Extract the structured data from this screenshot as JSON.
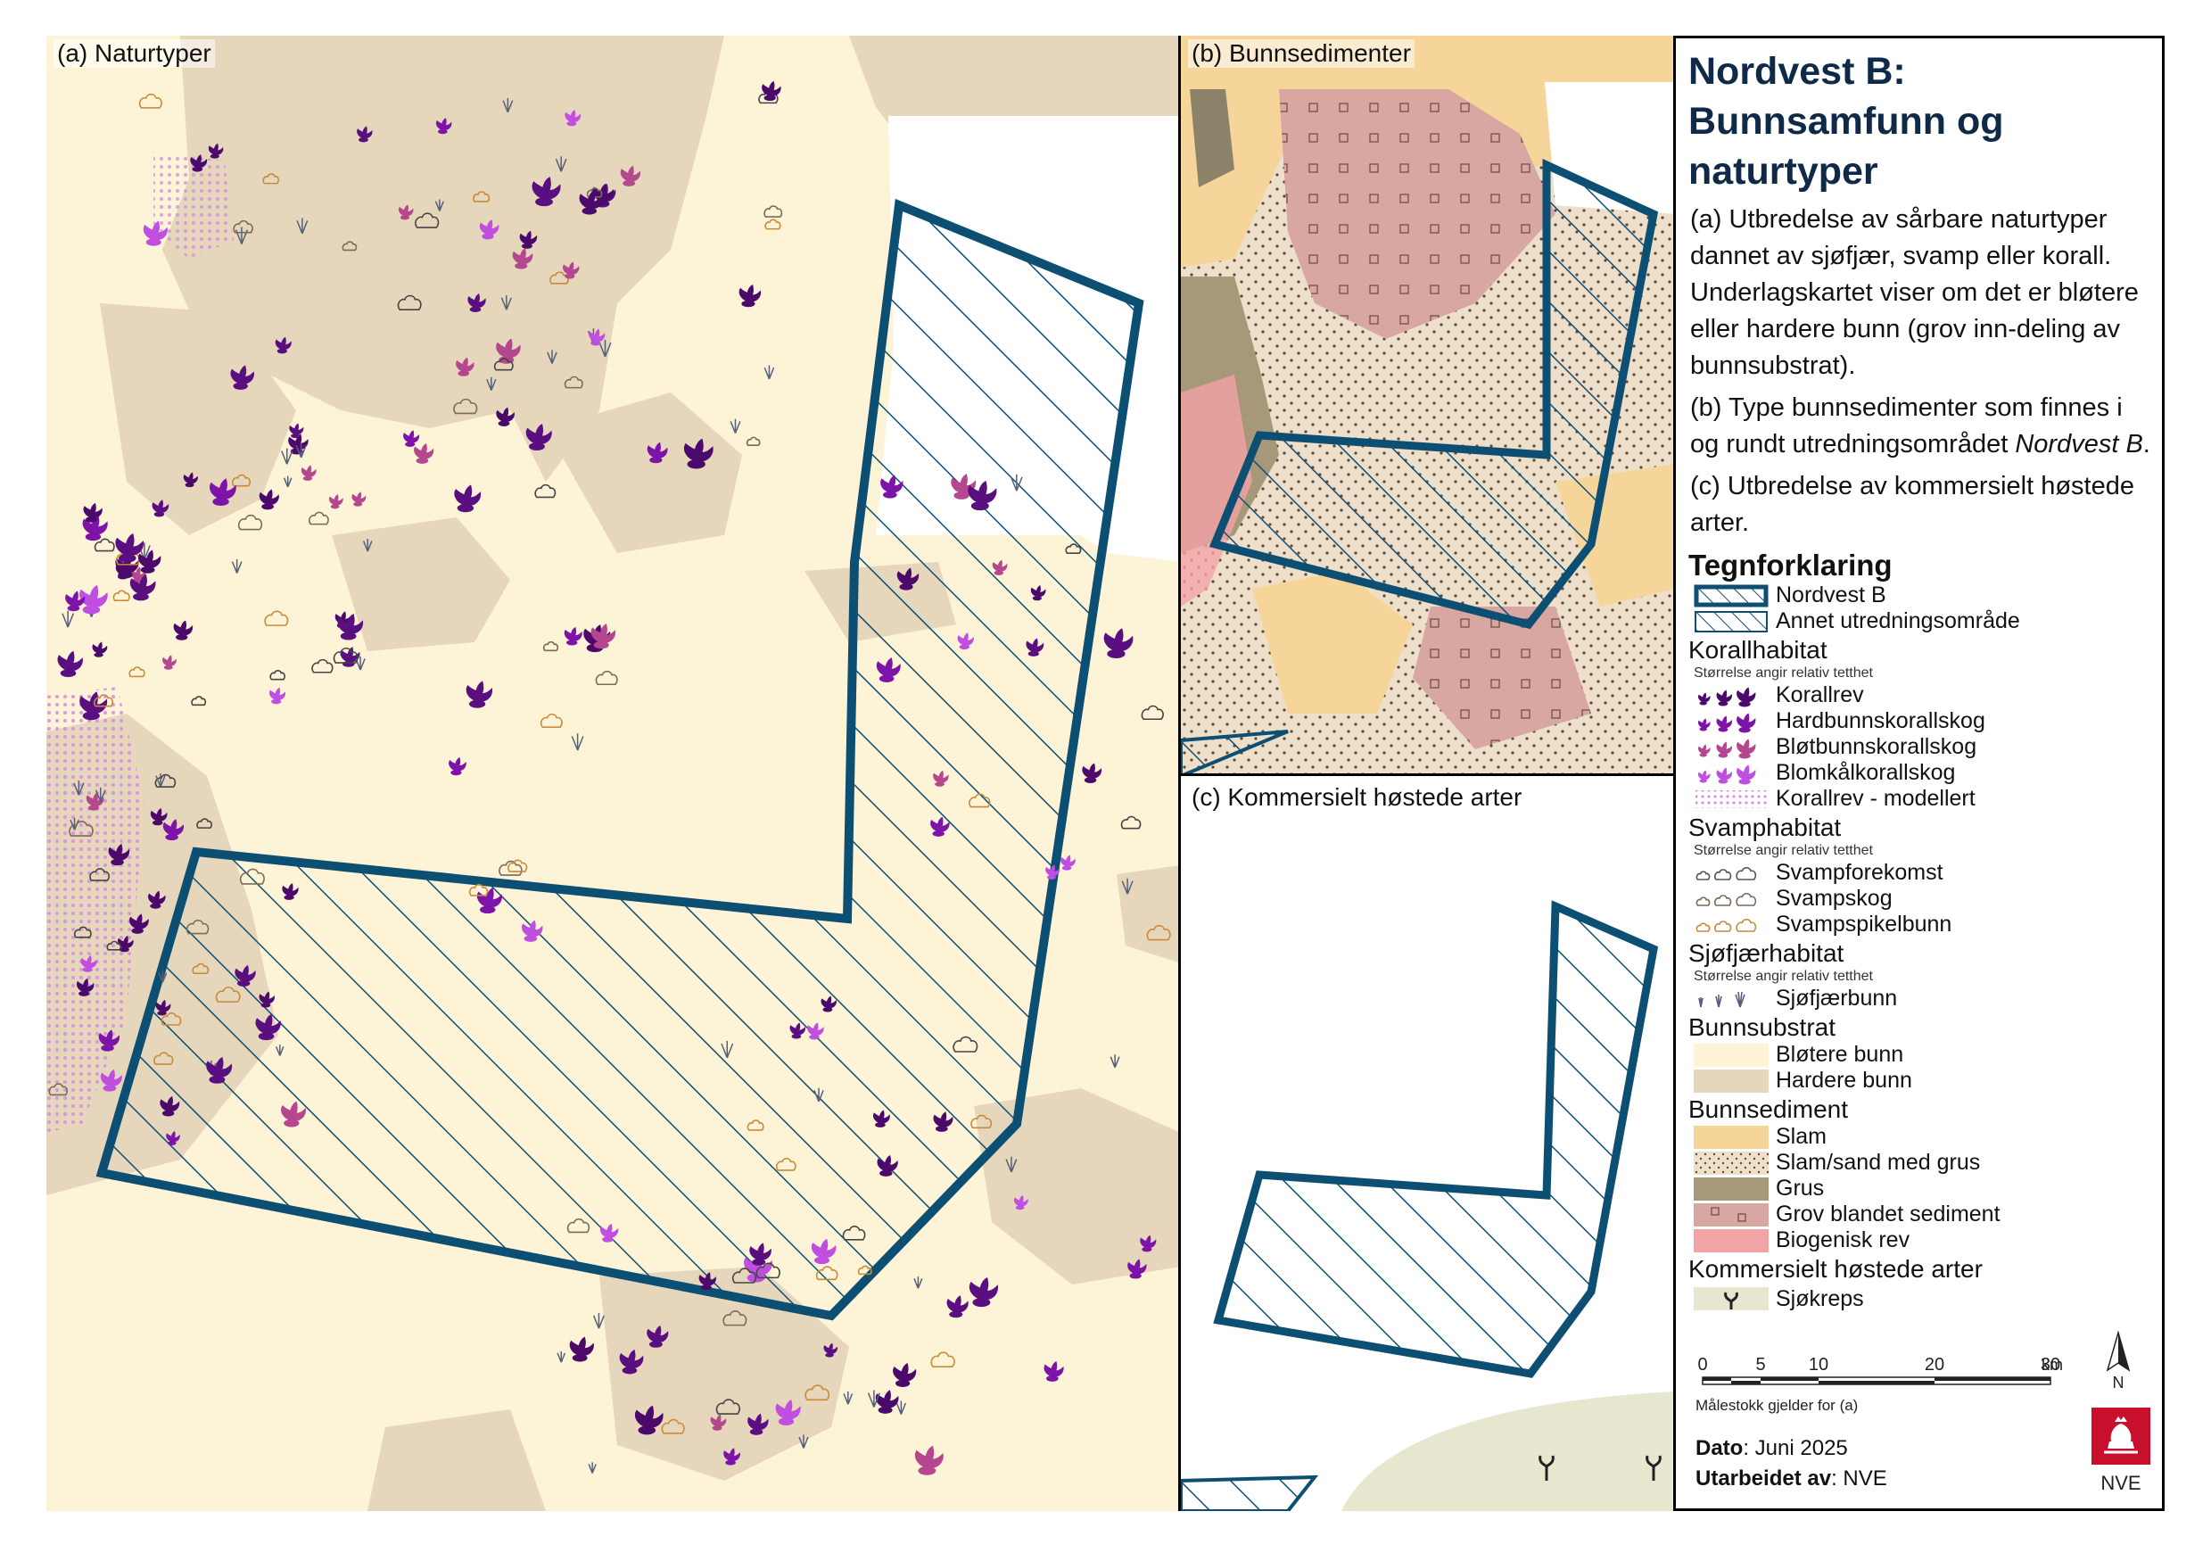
{
  "panels": {
    "a_label": "(a) Naturtyper",
    "b_label": "(b) Bunnsedimenter",
    "c_label": "(c) Kommersielt høstede arter"
  },
  "title_line1": "Nordvest B:",
  "title_line2": "Bunnsamfunn og naturtyper",
  "description": {
    "a": "(a) Utbredelse av sårbare naturtyper dannet av sjøfjær, svamp eller korall. Underlagskartet viser om det er bløtere eller hardere bunn (grov inn-deling av bunnsubstrat).",
    "b_prefix": "(b) Type bunnsedimenter som finnes i og rundt utredningsområdet ",
    "b_italic": "Nordvest B",
    "b_suffix": ".",
    "c": "(c) Utbredelse av kommersielt høstede arter."
  },
  "legend": {
    "title": "Tegnforklaring",
    "area_nordvest": "Nordvest B",
    "area_other": "Annet utredningsområde",
    "korall_head": "Korallhabitat",
    "density_note": "Størrelse angir relativ tetthet",
    "korallrev": "Korallrev",
    "hardbunn": "Hardbunnskorallskog",
    "blotbunn": "Bløtbunnskorallskog",
    "blomkal": "Blomkålkorallskog",
    "modellert": "Korallrev - modellert",
    "svamp_head": "Svamphabitat",
    "svampforekomst": "Svampforekomst",
    "svampskog": "Svampskog",
    "svampspikel": "Svampspikelbunn",
    "sjofjaer_head": "Sjøfjærhabitat",
    "sjofjaerbunn": "Sjøfjærbunn",
    "substrat_head": "Bunnsubstrat",
    "blotere": "Bløtere bunn",
    "hardere": "Hardere bunn",
    "sediment_head": "Bunnsediment",
    "slam": "Slam",
    "slam_sand": "Slam/sand med grus",
    "grus": "Grus",
    "grov": "Grov blandet sediment",
    "biogenisk": "Biogenisk rev",
    "kommersiell_head": "Kommersielt høstede arter",
    "sjokreps": "Sjøkreps"
  },
  "scale": {
    "ticks": [
      "0",
      "5",
      "10",
      "20",
      "30"
    ],
    "unit": "km",
    "note": "Målestokk gjelder for (a)"
  },
  "north_label": "N",
  "date_label": "Dato",
  "date_value": ": Juni 2025",
  "author_label": "Utarbeidet av",
  "author_value": ": NVE",
  "logo_text": "NVE",
  "colors": {
    "boundary": "#0d4f73",
    "soft_bottom": "#fdf3d6",
    "hard_bottom": "#e6d6bc",
    "coral_reef": "#4b0a6b",
    "hard_coral": "#7d13a8",
    "soft_coral": "#b5478f",
    "cauliflower": "#c04ee0",
    "slam": "#f6d59a",
    "grus": "#a8987a",
    "grov": "#d9a7a2",
    "biogenisk": "#f2a3a6"
  }
}
